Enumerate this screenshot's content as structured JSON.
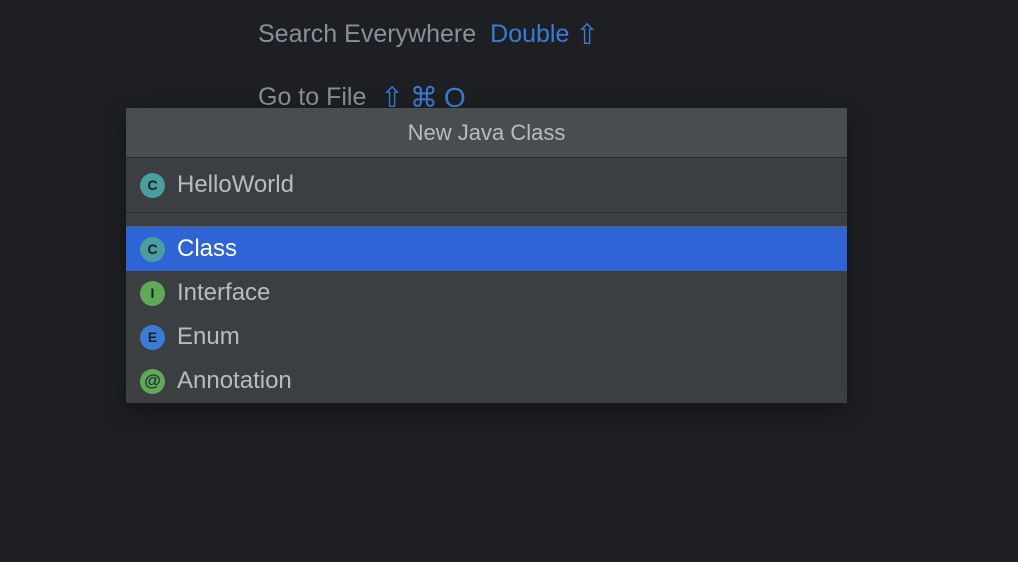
{
  "background": {
    "hints": [
      {
        "label": "Search Everywhere",
        "shortcut_text": "Double",
        "shortcut_glyphs": [
          "⇧"
        ]
      },
      {
        "label": "Go to File",
        "shortcut_text": "",
        "shortcut_glyphs": [
          "⇧",
          "⌘",
          "O"
        ]
      }
    ]
  },
  "dialog": {
    "title": "New Java Class",
    "input_value": "HelloWorld",
    "options": [
      {
        "icon_letter": "C",
        "icon_class": "icon-c",
        "label": "Class",
        "selected": true
      },
      {
        "icon_letter": "I",
        "icon_class": "icon-i",
        "label": "Interface",
        "selected": false
      },
      {
        "icon_letter": "E",
        "icon_class": "icon-e",
        "label": "Enum",
        "selected": false
      },
      {
        "icon_letter": "@",
        "icon_class": "icon-at",
        "label": "Annotation",
        "selected": false
      }
    ]
  }
}
